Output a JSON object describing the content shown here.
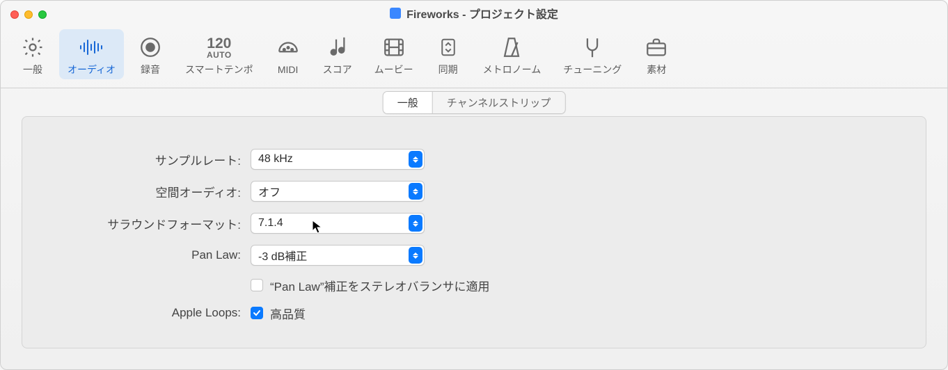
{
  "window": {
    "title": "Fireworks - プロジェクト設定"
  },
  "toolbar": {
    "items": [
      {
        "id": "general",
        "label": "一般"
      },
      {
        "id": "audio",
        "label": "オーディオ"
      },
      {
        "id": "record",
        "label": "録音"
      },
      {
        "id": "smarttempo",
        "label": "スマートテンポ",
        "tempo_value": "120",
        "tempo_mode": "AUTO"
      },
      {
        "id": "midi",
        "label": "MIDI"
      },
      {
        "id": "score",
        "label": "スコア"
      },
      {
        "id": "movie",
        "label": "ムービー"
      },
      {
        "id": "sync",
        "label": "同期"
      },
      {
        "id": "metronome",
        "label": "メトロノーム"
      },
      {
        "id": "tuning",
        "label": "チューニング"
      },
      {
        "id": "assets",
        "label": "素材"
      }
    ],
    "selected_id": "audio"
  },
  "segmented": {
    "options": [
      {
        "label": "一般",
        "active": true
      },
      {
        "label": "チャンネルストリップ",
        "active": false
      }
    ]
  },
  "form": {
    "sample_rate": {
      "label": "サンプルレート:",
      "value": "48 kHz"
    },
    "spatial_audio": {
      "label": "空間オーディオ:",
      "value": "オフ"
    },
    "surround_format": {
      "label": "サラウンドフォーマット:",
      "value": "7.1.4"
    },
    "pan_law": {
      "label": "Pan Law:",
      "value": "-3 dB補正"
    },
    "pan_law_checkbox": {
      "label": "",
      "text": "“Pan Law”補正をステレオバランサに適用",
      "checked": false
    },
    "apple_loops": {
      "label": "Apple Loops:",
      "text": "高品質",
      "checked": true
    }
  },
  "colors": {
    "accent": "#0a7aff",
    "toolbar_selected_bg": "#dce9f7",
    "toolbar_selected_fg": "#1767d6"
  }
}
